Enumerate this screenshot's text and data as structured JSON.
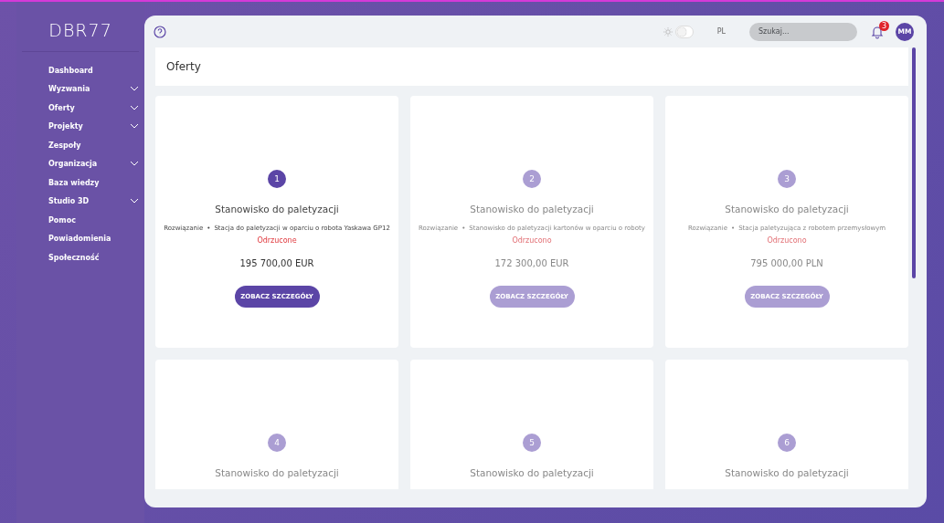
{
  "sidebar": {
    "logo": "DBR77",
    "items": [
      {
        "label": "Dashboard",
        "expandable": false
      },
      {
        "label": "Wyzwania",
        "expandable": true
      },
      {
        "label": "Oferty",
        "expandable": true
      },
      {
        "label": "Projekty",
        "expandable": true
      },
      {
        "label": "Zespoły",
        "expandable": false
      },
      {
        "label": "Organizacja",
        "expandable": true
      },
      {
        "label": "Baza wiedzy",
        "expandable": false
      },
      {
        "label": "Studio 3D",
        "expandable": true
      },
      {
        "label": "Pomoc",
        "expandable": false
      },
      {
        "label": "Powiadomienia",
        "expandable": false
      },
      {
        "label": "Społeczność",
        "expandable": false
      }
    ]
  },
  "topbar": {
    "theme_toggle": {
      "on": false
    },
    "language": "PL",
    "search": {
      "placeholder": "Szukaj..."
    },
    "notifications_badge": "3",
    "avatar": "MM"
  },
  "page_title": "Oferty",
  "offers": [
    {
      "number": "1",
      "title": "Stanowisko do paletyzacji",
      "selected": true,
      "category": "Rozwiązanie",
      "separator": "•",
      "solution": "Stacja do paletyzacji w oparciu o robota Yaskawa GP12",
      "status": "Odrzucone",
      "price": "195 700,00 EUR",
      "button": "ZOBACZ SZCZEGÓŁY"
    },
    {
      "number": "2",
      "title": "Stanowisko do paletyzacji",
      "selected": false,
      "category": "Rozwiązanie",
      "separator": "•",
      "solution": "Stanowisko do paletyzacji kartonów w oparciu o roboty",
      "status": "Odrzucono",
      "price": "172 300,00 EUR",
      "button": "ZOBACZ SZCZEGÓŁY"
    },
    {
      "number": "3",
      "title": "Stanowisko do paletyzacji",
      "selected": false,
      "category": "Rozwiązanie",
      "separator": "•",
      "solution": "Stacja paletyzująca z robotem przemysłowym",
      "status": "Odrzucono",
      "price": "795 000,00 PLN",
      "button": "ZOBACZ SZCZEGÓŁY"
    },
    {
      "number": "4",
      "title": "Stanowisko do paletyzacji",
      "selected": false
    },
    {
      "number": "5",
      "title": "Stanowisko do paletyzacji",
      "selected": false
    },
    {
      "number": "6",
      "title": "Stanowisko do paletyzacji",
      "selected": false
    }
  ]
}
